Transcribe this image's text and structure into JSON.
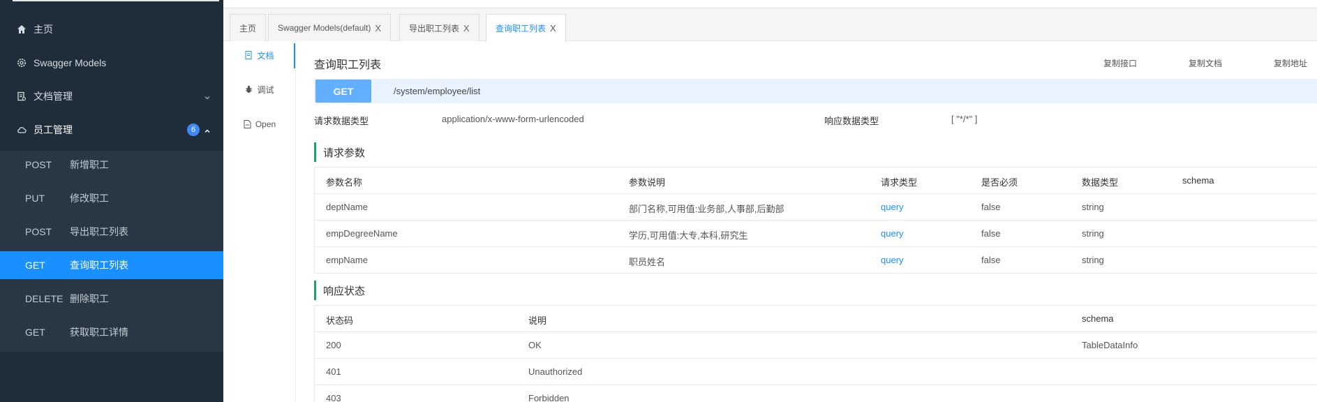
{
  "sidebar": {
    "items": [
      {
        "label": "主页",
        "icon": "home-icon"
      },
      {
        "label": "Swagger Models",
        "icon": "settings-icon"
      },
      {
        "label": "文档管理",
        "icon": "document-icon"
      },
      {
        "label": "员工管理",
        "icon": "cloud-icon",
        "badge": "6"
      }
    ],
    "submenu": [
      {
        "method": "POST",
        "title": "新增职工"
      },
      {
        "method": "PUT",
        "title": "修改职工"
      },
      {
        "method": "POST",
        "title": "导出职工列表"
      },
      {
        "method": "GET",
        "title": "查询职工列表",
        "active": true
      },
      {
        "method": "DELETE",
        "title": "删除职工"
      },
      {
        "method": "GET",
        "title": "获取职工详情"
      }
    ]
  },
  "tabs": [
    {
      "label": "主页"
    },
    {
      "label": "Swagger Models(default)",
      "close": "X"
    },
    {
      "label": "导出职工列表",
      "close": "X"
    },
    {
      "label": "查询职工列表",
      "close": "X",
      "active": true
    }
  ],
  "docnav": [
    {
      "label": "文档",
      "icon": "doc-icon"
    },
    {
      "label": "调试",
      "icon": "bug-icon"
    },
    {
      "label": "Open",
      "icon": "file-icon"
    }
  ],
  "api": {
    "title": "查询职工列表",
    "copy_api": "复制接口",
    "copy_doc": "复制文档",
    "copy_url": "复制地址",
    "method": "GET",
    "path": "/system/employee/list",
    "req_type_label": "请求数据类型",
    "req_type_value": "application/x-www-form-urlencoded",
    "resp_type_label": "响应数据类型",
    "resp_type_value": "[ \"*/*\" ]"
  },
  "params": {
    "title": "请求参数",
    "headers": [
      "参数名称",
      "参数说明",
      "请求类型",
      "是否必须",
      "数据类型",
      "schema"
    ],
    "rows": [
      [
        "deptName",
        "部门名称,可用值:业务部,人事部,后勤部",
        "query",
        "false",
        "string",
        ""
      ],
      [
        "empDegreeName",
        "学历,可用值:大专,本科,研究生",
        "query",
        "false",
        "string",
        ""
      ],
      [
        "empName",
        "职员姓名",
        "query",
        "false",
        "string",
        ""
      ]
    ]
  },
  "responses": {
    "title": "响应状态",
    "headers": [
      "状态码",
      "说明",
      "schema"
    ],
    "rows": [
      [
        "200",
        "OK",
        "TableDataInfo"
      ],
      [
        "401",
        "Unauthorized",
        ""
      ],
      [
        "403",
        "Forbidden",
        ""
      ]
    ]
  },
  "colors": {
    "sidebar_bg": "#1f2d3a",
    "submenu_bg": "#283743",
    "active_blue": "#1890ff",
    "get_blue": "#61affe",
    "section_green": "#21a26a"
  }
}
